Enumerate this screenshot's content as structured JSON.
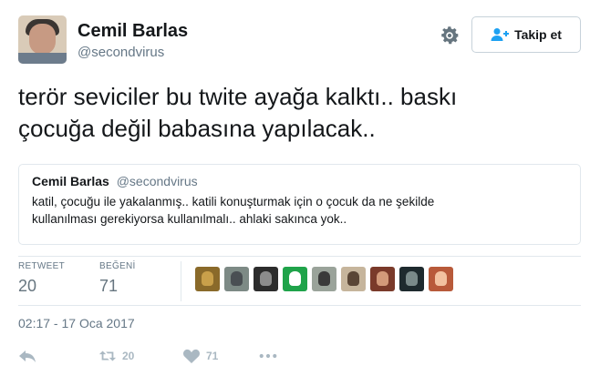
{
  "author": {
    "name": "Cemil Barlas",
    "handle": "@secondvirus"
  },
  "header": {
    "follow_label": "Takip et"
  },
  "tweet": {
    "text": "terör seviciler bu twite ayağa kalktı.. baskı\nçocuğa değil babasına yapılacak.."
  },
  "quoted": {
    "name": "Cemil Barlas",
    "handle": "@secondvirus",
    "text": "katil, çocuğu ile yakalanmış.. katili konuşturmak için o çocuk da ne şekilde\nkullanılması gerekiyorsa kullanılmalı.. ahlaki sakınca yok.."
  },
  "stats": {
    "retweet_label": "RETWEET",
    "retweet_count": "20",
    "like_label": "BEĞENİ",
    "like_count": "71"
  },
  "likers": [
    {
      "icon": "liker-avatar",
      "bg": "#8a6a2a",
      "fg": "#c9a04a"
    },
    {
      "icon": "liker-avatar",
      "bg": "#7d8a85",
      "fg": "#4a4f53"
    },
    {
      "icon": "liker-avatar",
      "bg": "#2c2c2c",
      "fg": "#8c8c8c"
    },
    {
      "icon": "liker-avatar",
      "bg": "#1fa34a",
      "fg": "#ffffff"
    },
    {
      "icon": "liker-avatar",
      "bg": "#9aa39a",
      "fg": "#3a3a3a"
    },
    {
      "icon": "liker-avatar",
      "bg": "#c6b59c",
      "fg": "#5a4636"
    },
    {
      "icon": "liker-avatar",
      "bg": "#7a3a2a",
      "fg": "#d39a7a"
    },
    {
      "icon": "liker-avatar",
      "bg": "#1e2a2e",
      "fg": "#7a8a8a"
    },
    {
      "icon": "liker-avatar",
      "bg": "#b85a3a",
      "fg": "#f2c2a0"
    }
  ],
  "timestamp": "02:17 - 17 Oca 2017",
  "actions": {
    "reply_icon": "reply-icon",
    "retweet_icon": "retweet-icon",
    "retweet_count": "20",
    "like_icon": "heart-icon",
    "like_count": "71",
    "more_icon": "more-icon"
  },
  "colors": {
    "text": "#14171a",
    "secondary": "#657786",
    "border": "#e1e8ed",
    "action_gray": "#aab8c2"
  }
}
